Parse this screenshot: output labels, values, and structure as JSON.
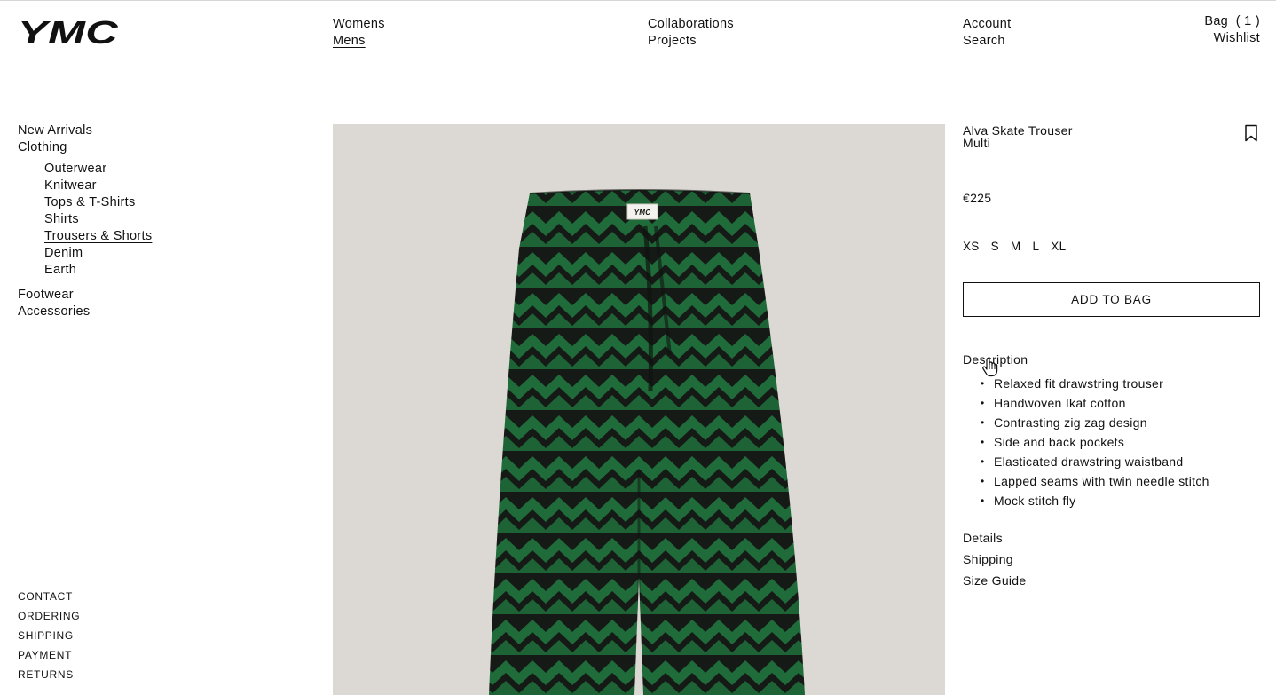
{
  "header": {
    "logo": "YMC",
    "nav_col1": [
      "Womens",
      "Mens"
    ],
    "nav_col2": [
      "Collaborations",
      "Projects"
    ],
    "nav_col3": [
      "Account",
      "Search"
    ],
    "bag_label": "Bag",
    "bag_count": "( 1 )",
    "wishlist": "Wishlist"
  },
  "sidebar": {
    "new_arrivals": "New Arrivals",
    "clothing": "Clothing",
    "subcategories": [
      "Outerwear",
      "Knitwear",
      "Tops & T-Shirts",
      "Shirts",
      "Trousers & Shorts",
      "Denim",
      "Earth"
    ],
    "active_subcategory": "Trousers & Shorts",
    "footwear": "Footwear",
    "accessories": "Accessories"
  },
  "footer_links": [
    "CONTACT",
    "ORDERING",
    "SHIPPING",
    "PAYMENT",
    "RETURNS"
  ],
  "product": {
    "name": "Alva Skate Trouser",
    "color": "Multi",
    "price": "€225",
    "sizes": [
      "XS",
      "S",
      "M",
      "L",
      "XL"
    ],
    "add_to_bag": "ADD TO BAG",
    "description_title": "Description",
    "description_items": [
      "Relaxed fit drawstring trouser",
      "Handwoven Ikat cotton",
      "Contrasting zig zag design",
      "Side and back pockets",
      "Elasticated drawstring waistband",
      "Lapped seams with twin needle stitch",
      "Mock stitch fly"
    ],
    "details": "Details",
    "shipping": "Shipping",
    "size_guide": "Size Guide",
    "label_text": "YMC"
  },
  "colors": {
    "image_bg": "#dcd8d3",
    "trouser_green": "#1f6b3a",
    "trouser_black": "#151a16"
  }
}
